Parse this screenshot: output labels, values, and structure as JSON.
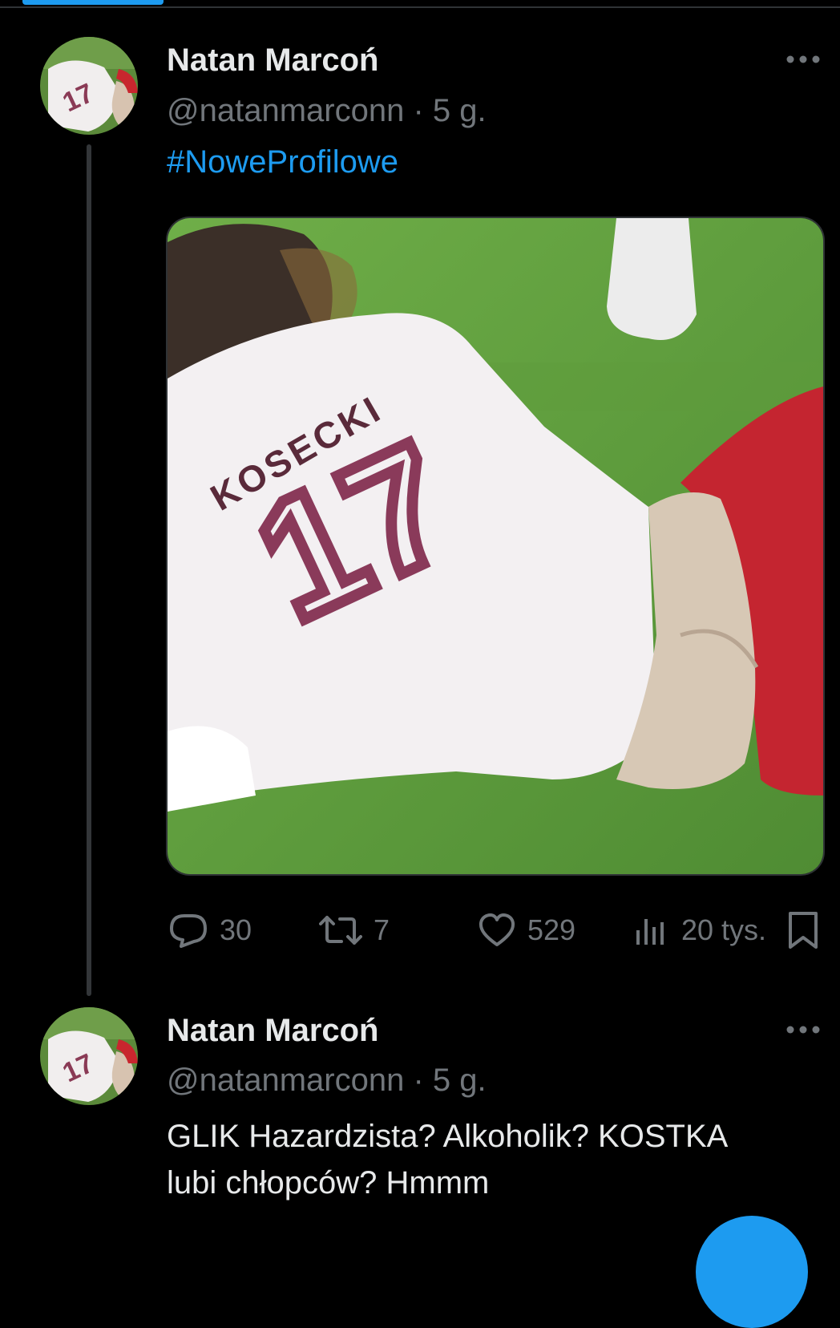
{
  "tweets": [
    {
      "author_name": "Natan Marcoń",
      "handle_time": "@natanmarconn · 5 g.",
      "hashtag": "#NoweProfilowe",
      "more_icon": "ellipsis-icon",
      "stats": {
        "replies": "30",
        "reposts": "7",
        "likes": "529",
        "views": "20 tys."
      }
    },
    {
      "author_name": "Natan Marcoń",
      "handle_time": "@natanmarconn · 5 g.",
      "text_line1": "GLIK Hazardzista? Alkoholik? KOSTKA",
      "text_line2": "lubi chłopców? Hmmm",
      "more_icon": "ellipsis-icon"
    }
  ],
  "media": {
    "jersey_name": "KOSECKI",
    "jersey_number": "17"
  },
  "colors": {
    "accent": "#1d9bf0",
    "secondary_text": "#71767b",
    "primary_text": "#e7e9ea",
    "background": "#000000"
  }
}
